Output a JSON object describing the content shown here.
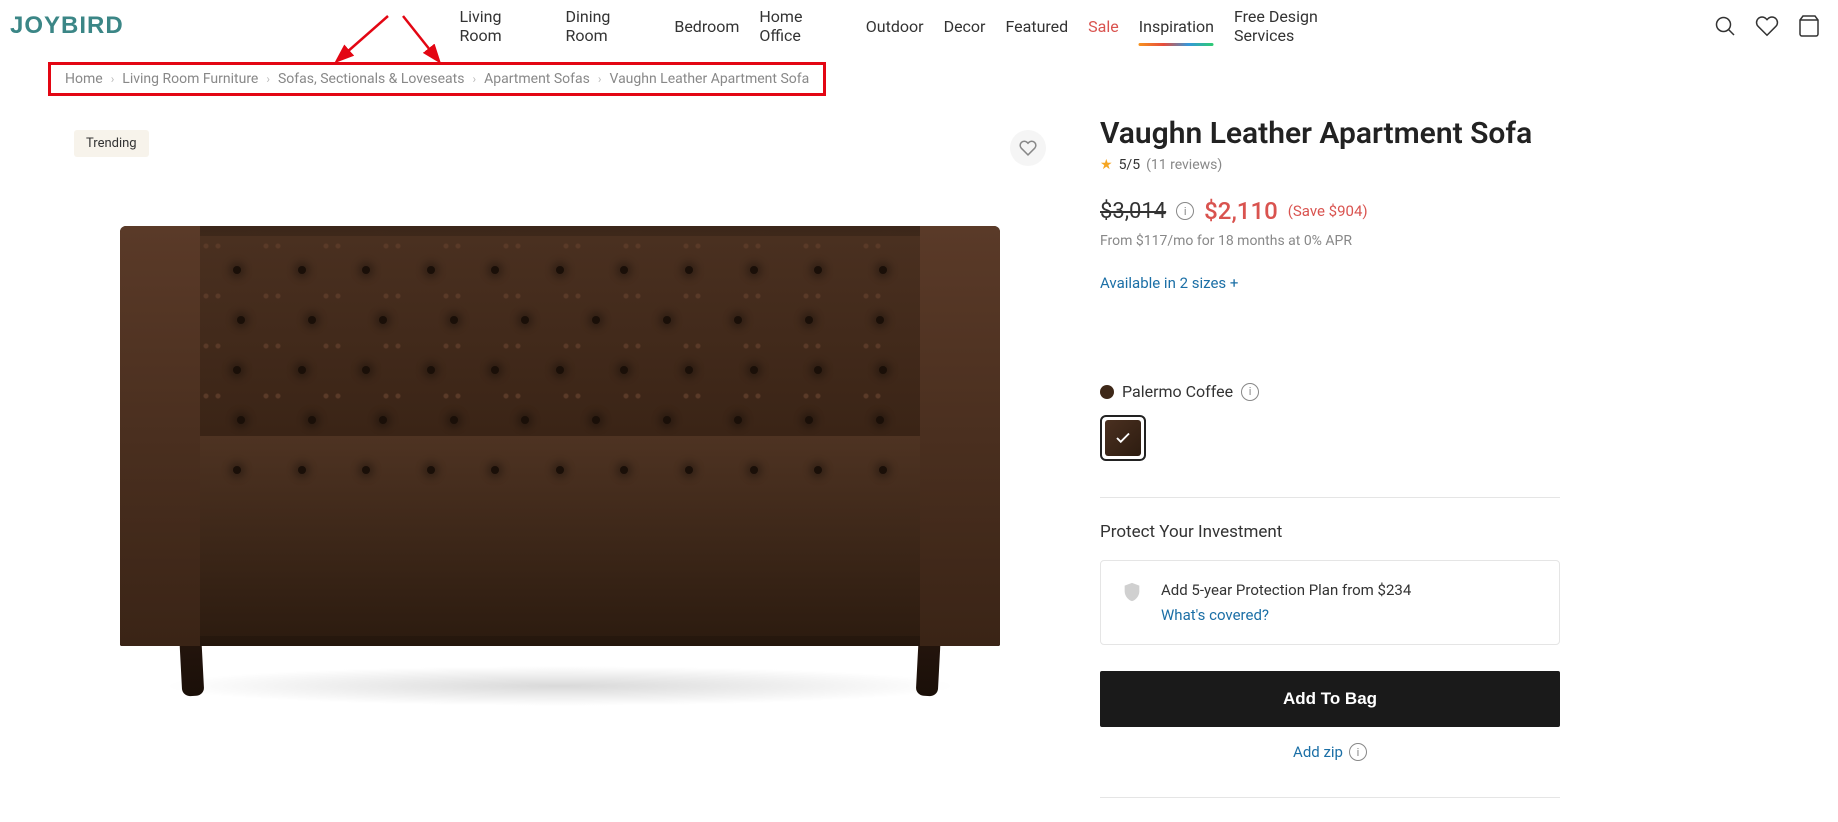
{
  "logo": "JOYBIRD",
  "nav": {
    "living": "Living Room",
    "dining": "Dining Room",
    "bedroom": "Bedroom",
    "office": "Home Office",
    "outdoor": "Outdoor",
    "decor": "Decor",
    "featured": "Featured",
    "sale": "Sale",
    "inspiration": "Inspiration",
    "services": "Free Design Services"
  },
  "breadcrumb": {
    "home": "Home",
    "cat1": "Living Room Furniture",
    "cat2": "Sofas, Sectionals & Loveseats",
    "cat3": "Apartment Sofas",
    "current": "Vaughn Leather Apartment Sofa"
  },
  "gallery": {
    "badge": "Trending"
  },
  "product": {
    "title": "Vaughn Leather Apartment Sofa",
    "rating": "5/5",
    "reviews": "(11 reviews)",
    "old_price": "$3,014",
    "new_price": "$2,110",
    "save": "(Save $904)",
    "finance": "From $117/mo for 18 months at 0% APR",
    "sizes_link": "Available in 2 sizes +",
    "color_name": "Palermo Coffee",
    "protect_title": "Protect Your Investment",
    "protect_text": "Add 5-year Protection Plan from $234",
    "protect_link": "What's covered?",
    "add_to_bag": "Add To Bag",
    "add_zip": "Add zip"
  }
}
